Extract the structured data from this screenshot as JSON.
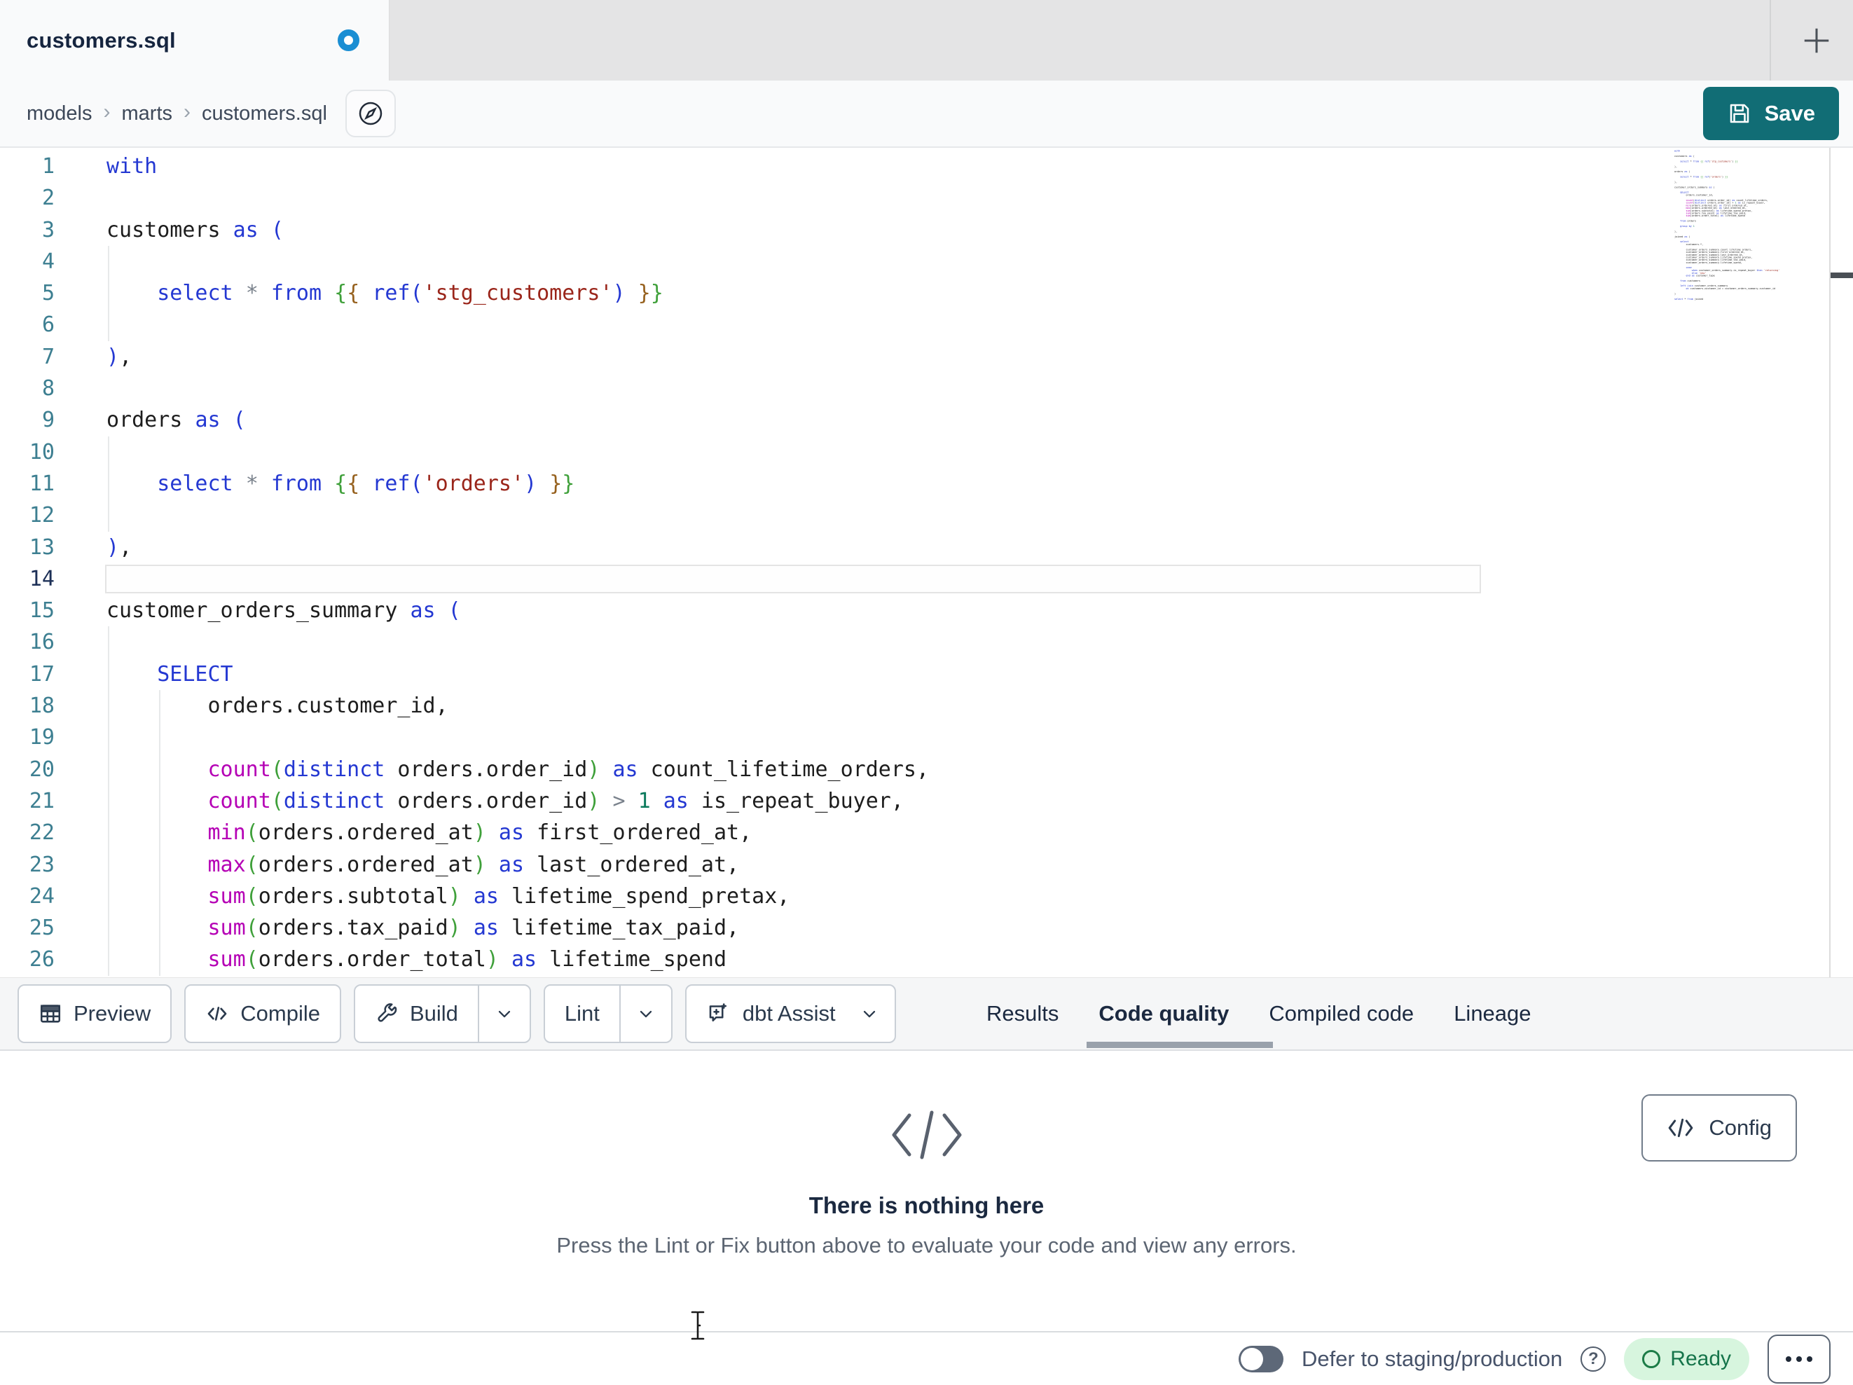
{
  "tab_bar": {
    "tab_title": "customers.sql"
  },
  "breadcrumb": {
    "items": [
      "models",
      "marts",
      "customers.sql"
    ],
    "separator": "›"
  },
  "save": {
    "label": "Save"
  },
  "icons": {
    "unsaved": "blue-dot",
    "new_tab": "plus",
    "breadcrumb_nav": "compass",
    "save": "floppy-disk",
    "preview": "table-grid",
    "compile": "code-brackets",
    "build": "wrench",
    "assist": "chat-sparkle",
    "dropdown": "chevron-down",
    "empty_state": "code-brackets",
    "config": "code-brackets",
    "help": "question-circle",
    "ready": "circle-outline",
    "more": "ellipsis",
    "mouse": "text-ibeam"
  },
  "colors": {
    "save_button": "#116d75",
    "unsaved_dot": "#1b8ed3",
    "tabbar_bg": "#e4e4e5",
    "active_tab_bg": "#f9fafb",
    "keyword": "#2438d2",
    "function": "#b500b5",
    "string": "#9a251a",
    "number": "#0c7a5c",
    "bracket_green": "#3fa03a",
    "bracket_brown": "#96611e",
    "line_number": "#3d7f91",
    "ready_bg": "#d7f5de",
    "ready_fg": "#15744a",
    "tab_underline": "#99a1ab"
  },
  "toolbar": {
    "preview": "Preview",
    "compile": "Compile",
    "build": "Build",
    "lint": "Lint",
    "assist": "dbt Assist"
  },
  "panel_tabs": {
    "items": [
      {
        "label": "Results",
        "active": false
      },
      {
        "label": "Code quality",
        "active": true
      },
      {
        "label": "Compiled code",
        "active": false
      },
      {
        "label": "Lineage",
        "active": false
      }
    ]
  },
  "empty_state": {
    "title": "There is nothing here",
    "subtitle": "Press the Lint or Fix button above to evaluate your code and view any errors."
  },
  "config": {
    "label": "Config"
  },
  "status_bar": {
    "defer_label": "Defer to staging/production",
    "ready": "Ready"
  },
  "editor": {
    "active_line": 14,
    "lines": [
      {
        "n": 1,
        "g": 0,
        "tk": [
          [
            "k",
            "with"
          ]
        ]
      },
      {
        "n": 2,
        "g": 0,
        "tk": []
      },
      {
        "n": 3,
        "g": 0,
        "tk": [
          [
            "t",
            "customers "
          ],
          [
            "k",
            "as"
          ],
          [
            "t",
            " "
          ],
          [
            "b1",
            "("
          ]
        ]
      },
      {
        "n": 4,
        "g": 1,
        "tk": []
      },
      {
        "n": 5,
        "g": 1,
        "tk": [
          [
            "t",
            "    "
          ],
          [
            "k",
            "select"
          ],
          [
            "t",
            " "
          ],
          [
            "o",
            "*"
          ],
          [
            "t",
            " "
          ],
          [
            "k",
            "from"
          ],
          [
            "t",
            " "
          ],
          [
            "b2",
            "{"
          ],
          [
            "b3",
            "{"
          ],
          [
            "t",
            " "
          ],
          [
            "k",
            "ref"
          ],
          [
            "b1",
            "("
          ],
          [
            "s",
            "'stg_customers'"
          ],
          [
            "b1",
            ")"
          ],
          [
            "t",
            " "
          ],
          [
            "b3",
            "}"
          ],
          [
            "b2",
            "}"
          ]
        ]
      },
      {
        "n": 6,
        "g": 1,
        "tk": []
      },
      {
        "n": 7,
        "g": 0,
        "tk": [
          [
            "b1",
            ")"
          ],
          [
            "t",
            ","
          ]
        ]
      },
      {
        "n": 8,
        "g": 0,
        "tk": []
      },
      {
        "n": 9,
        "g": 0,
        "tk": [
          [
            "t",
            "orders "
          ],
          [
            "k",
            "as"
          ],
          [
            "t",
            " "
          ],
          [
            "b1",
            "("
          ]
        ]
      },
      {
        "n": 10,
        "g": 1,
        "tk": []
      },
      {
        "n": 11,
        "g": 1,
        "tk": [
          [
            "t",
            "    "
          ],
          [
            "k",
            "select"
          ],
          [
            "t",
            " "
          ],
          [
            "o",
            "*"
          ],
          [
            "t",
            " "
          ],
          [
            "k",
            "from"
          ],
          [
            "t",
            " "
          ],
          [
            "b2",
            "{"
          ],
          [
            "b3",
            "{"
          ],
          [
            "t",
            " "
          ],
          [
            "k",
            "ref"
          ],
          [
            "b1",
            "("
          ],
          [
            "s",
            "'orders'"
          ],
          [
            "b1",
            ")"
          ],
          [
            "t",
            " "
          ],
          [
            "b3",
            "}"
          ],
          [
            "b2",
            "}"
          ]
        ]
      },
      {
        "n": 12,
        "g": 1,
        "tk": []
      },
      {
        "n": 13,
        "g": 0,
        "tk": [
          [
            "b1",
            ")"
          ],
          [
            "t",
            ","
          ]
        ]
      },
      {
        "n": 14,
        "g": 0,
        "tk": []
      },
      {
        "n": 15,
        "g": 0,
        "tk": [
          [
            "t",
            "customer_orders_summary "
          ],
          [
            "k",
            "as"
          ],
          [
            "t",
            " "
          ],
          [
            "b1",
            "("
          ]
        ]
      },
      {
        "n": 16,
        "g": 1,
        "tk": []
      },
      {
        "n": 17,
        "g": 1,
        "tk": [
          [
            "t",
            "    "
          ],
          [
            "k",
            "SELECT"
          ]
        ]
      },
      {
        "n": 18,
        "g": 2,
        "tk": [
          [
            "t",
            "        orders.customer_id,"
          ]
        ]
      },
      {
        "n": 19,
        "g": 2,
        "tk": []
      },
      {
        "n": 20,
        "g": 2,
        "tk": [
          [
            "t",
            "        "
          ],
          [
            "f",
            "count"
          ],
          [
            "b2",
            "("
          ],
          [
            "k",
            "distinct"
          ],
          [
            "t",
            " orders.order_id"
          ],
          [
            "b2",
            ")"
          ],
          [
            "t",
            " "
          ],
          [
            "k",
            "as"
          ],
          [
            "t",
            " count_lifetime_orders,"
          ]
        ]
      },
      {
        "n": 21,
        "g": 2,
        "tk": [
          [
            "t",
            "        "
          ],
          [
            "f",
            "count"
          ],
          [
            "b2",
            "("
          ],
          [
            "k",
            "distinct"
          ],
          [
            "t",
            " orders.order_id"
          ],
          [
            "b2",
            ")"
          ],
          [
            "t",
            " "
          ],
          [
            "o",
            ">"
          ],
          [
            "t",
            " "
          ],
          [
            "n",
            "1"
          ],
          [
            "t",
            " "
          ],
          [
            "k",
            "as"
          ],
          [
            "t",
            " is_repeat_buyer,"
          ]
        ]
      },
      {
        "n": 22,
        "g": 2,
        "tk": [
          [
            "t",
            "        "
          ],
          [
            "f",
            "min"
          ],
          [
            "b2",
            "("
          ],
          [
            "t",
            "orders.ordered_at"
          ],
          [
            "b2",
            ")"
          ],
          [
            "t",
            " "
          ],
          [
            "k",
            "as"
          ],
          [
            "t",
            " first_ordered_at,"
          ]
        ]
      },
      {
        "n": 23,
        "g": 2,
        "tk": [
          [
            "t",
            "        "
          ],
          [
            "f",
            "max"
          ],
          [
            "b2",
            "("
          ],
          [
            "t",
            "orders.ordered_at"
          ],
          [
            "b2",
            ")"
          ],
          [
            "t",
            " "
          ],
          [
            "k",
            "as"
          ],
          [
            "t",
            " last_ordered_at,"
          ]
        ]
      },
      {
        "n": 24,
        "g": 2,
        "tk": [
          [
            "t",
            "        "
          ],
          [
            "f",
            "sum"
          ],
          [
            "b2",
            "("
          ],
          [
            "t",
            "orders.subtotal"
          ],
          [
            "b2",
            ")"
          ],
          [
            "t",
            " "
          ],
          [
            "k",
            "as"
          ],
          [
            "t",
            " lifetime_spend_pretax,"
          ]
        ]
      },
      {
        "n": 25,
        "g": 2,
        "tk": [
          [
            "t",
            "        "
          ],
          [
            "f",
            "sum"
          ],
          [
            "b2",
            "("
          ],
          [
            "t",
            "orders.tax_paid"
          ],
          [
            "b2",
            ")"
          ],
          [
            "t",
            " "
          ],
          [
            "k",
            "as"
          ],
          [
            "t",
            " lifetime_tax_paid,"
          ]
        ]
      },
      {
        "n": 26,
        "g": 2,
        "tk": [
          [
            "t",
            "        "
          ],
          [
            "f",
            "sum"
          ],
          [
            "b2",
            "("
          ],
          [
            "t",
            "orders.order_total"
          ],
          [
            "b2",
            ")"
          ],
          [
            "t",
            " "
          ],
          [
            "k",
            "as"
          ],
          [
            "t",
            " lifetime_spend"
          ]
        ]
      }
    ],
    "minimap_lines": [
      "with",
      "",
      "customers as (",
      "",
      "    select * from {{ ref('stg_customers') }}",
      "",
      "),",
      "",
      "orders as (",
      "",
      "    select * from {{ ref('orders') }}",
      "",
      "),",
      "",
      "customer_orders_summary as (",
      "",
      "    SELECT",
      "        orders.customer_id,",
      "",
      "        count(distinct orders.order_id) as count_lifetime_orders,",
      "        count(distinct orders.order_id) > 1 as is_repeat_buyer,",
      "        min(orders.ordered_at) as first_ordered_at,",
      "        max(orders.ordered_at) as last_ordered_at,",
      "        sum(orders.subtotal) as lifetime_spend_pretax,",
      "        sum(orders.tax_paid) as lifetime_tax_paid,",
      "        sum(orders.order_total) as lifetime_spend",
      "",
      "    from orders",
      "",
      "    group by 1",
      "",
      "),",
      "",
      "joined as (",
      "",
      "    select",
      "        customers.*,",
      "",
      "        customer_orders_summary.count_lifetime_orders,",
      "        customer_orders_summary.first_ordered_at,",
      "        customer_orders_summary.last_ordered_at,",
      "        customer_orders_summary.lifetime_spend_pretax,",
      "        customer_orders_summary.lifetime_tax_paid,",
      "        customer_orders_summary.lifetime_spend,",
      "",
      "        case",
      "            when customer_orders_summary.is_repeat_buyer then 'returning'",
      "            else 'new'",
      "        end as customer_type",
      "",
      "    from customers",
      "",
      "    left join customer_orders_summary",
      "        on customers.customer_id = customer_orders_summary.customer_id",
      "",
      ")",
      "",
      "select * from joined"
    ]
  }
}
